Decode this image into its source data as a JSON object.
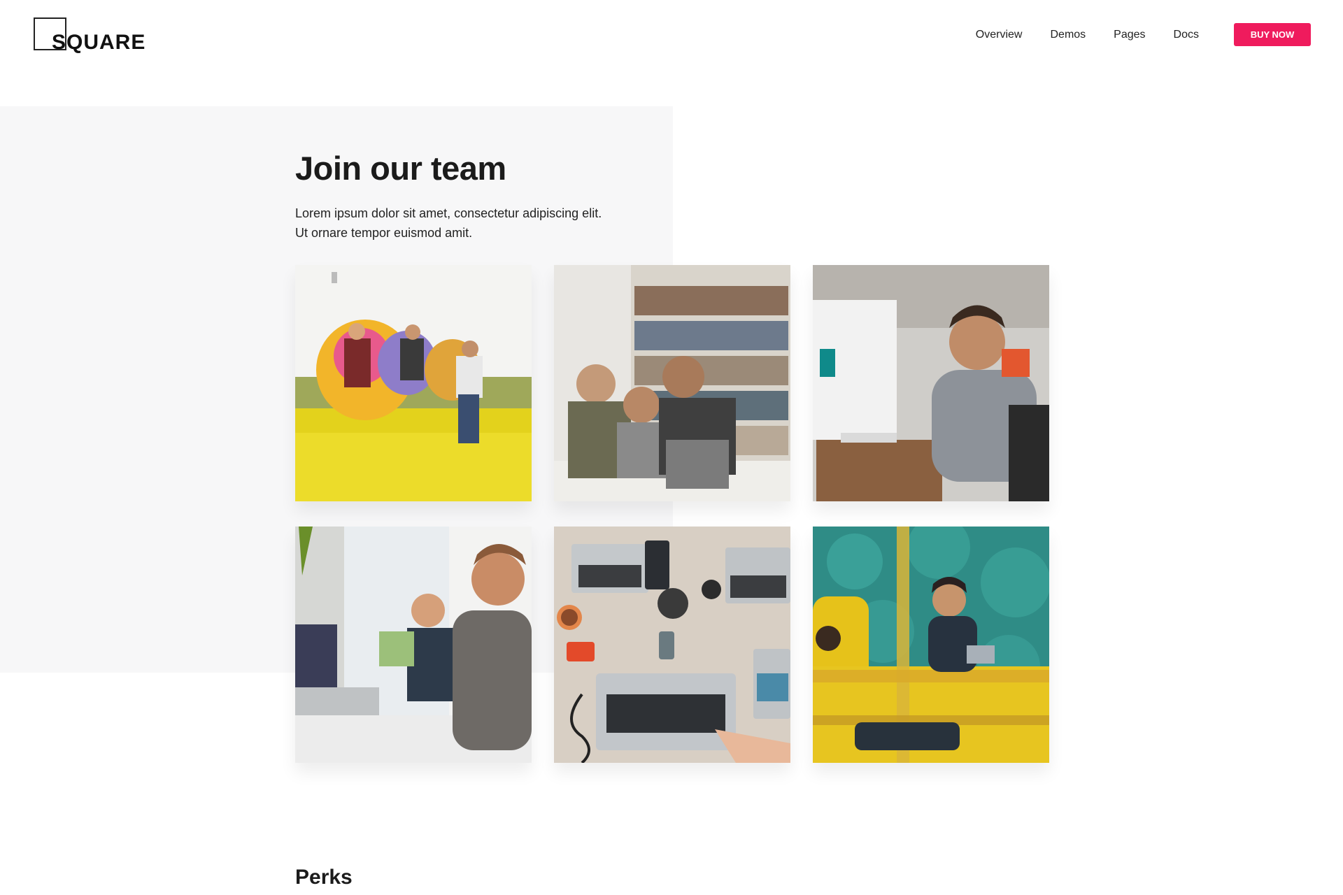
{
  "header": {
    "logo": "SQUARE",
    "nav": [
      "Overview",
      "Demos",
      "Pages",
      "Docs"
    ],
    "cta": "BUY NOW"
  },
  "hero": {
    "title": "Join our team",
    "lead_lines": [
      "Lorem ipsum dolor sit amet, consectetur adipiscing elit.",
      "Ut ornare tempor euismod amit."
    ]
  },
  "gallery": [
    {
      "subject": "friends-jumping-balloons"
    },
    {
      "subject": "team-laughing-library"
    },
    {
      "subject": "man-at-imac"
    },
    {
      "subject": "men-coding-office"
    },
    {
      "subject": "desk-laptops-overhead"
    },
    {
      "subject": "man-laptop-yellow-lounge"
    }
  ],
  "sections": {
    "perks_title": "Perks"
  },
  "colors": {
    "accent": "#ef1b5d",
    "band": "#f7f7f8",
    "text": "#1e1e1e"
  }
}
